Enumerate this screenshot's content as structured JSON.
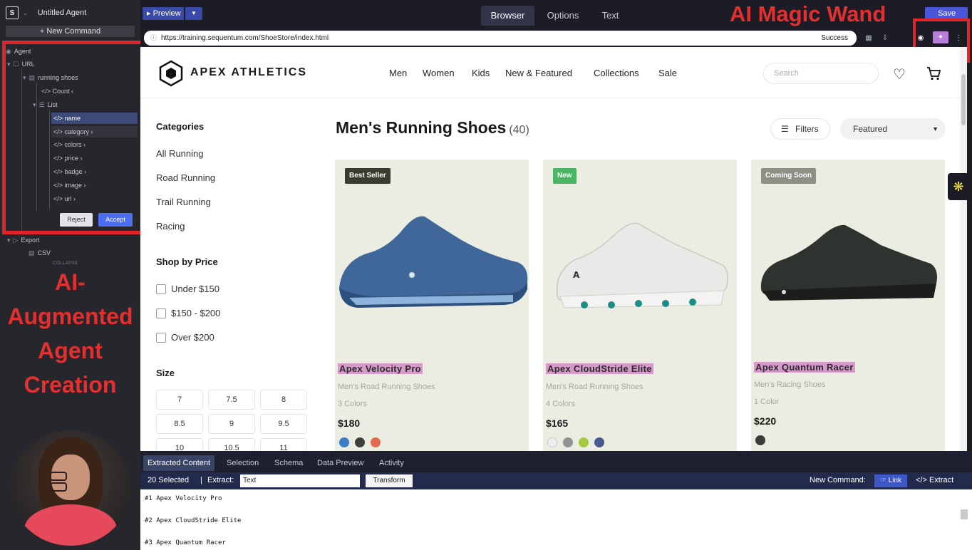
{
  "left_panel": {
    "title": "Untitled Agent",
    "new_command": "+ New Command",
    "tree": {
      "agent": "Agent",
      "url": "URL",
      "running_shoes": "running shoes",
      "count": "</> Count ‹",
      "list": "List",
      "fields": [
        "</> name",
        "</> category ›",
        "</> colors ›",
        "</> price ›",
        "</> badge ›",
        "</> image ›",
        "</> url ›"
      ],
      "export": "Export",
      "csv": "CSV",
      "collapse": "COLLAPSE"
    },
    "reject": "Reject",
    "accept": "Accept"
  },
  "annotations": {
    "left": [
      "AI-",
      "Augmented",
      "Agent",
      "Creation"
    ],
    "wand": "AI Magic Wand",
    "color": "#e0262b"
  },
  "toolbar": {
    "preview": "Preview",
    "tabs": [
      "Browser",
      "Options",
      "Text"
    ],
    "save": "Save"
  },
  "urlbar": {
    "url": "https://training.sequentum.com/ShoeStore/index.html",
    "status": "Success"
  },
  "site": {
    "brand": "APEX ATHLETICS",
    "nav": [
      "Men",
      "Women",
      "Kids",
      "New & Featured",
      "Collections",
      "Sale"
    ],
    "search_placeholder": "Search",
    "categories_heading": "Categories",
    "categories": [
      "All Running",
      "Road Running",
      "Trail Running",
      "Racing"
    ],
    "price_heading": "Shop by Price",
    "price_filters": [
      "Under $150",
      "$150 - $200",
      "Over $200"
    ],
    "size_heading": "Size",
    "sizes": [
      "7",
      "7.5",
      "8",
      "8.5",
      "9",
      "9.5",
      "10",
      "10.5",
      "11"
    ],
    "page_title": "Men's Running Shoes",
    "page_count": "(40)",
    "filters": "Filters",
    "sort": "Featured",
    "products": [
      {
        "badge": "Best Seller",
        "badge_color": "#3a3a2e",
        "name": "Apex Velocity Pro",
        "subtitle": "Men's Road Running Shoes",
        "colors_text": "3 Colors",
        "price": "$180",
        "swatches": [
          "#3b7dc4",
          "#3c3f3c",
          "#e36b4f"
        ],
        "shoe_color": "#3f679a"
      },
      {
        "badge": "New",
        "badge_color": "#4cb564",
        "name": "Apex CloudStride Elite",
        "subtitle": "Men's Road Running Shoes",
        "colors_text": "4 Colors",
        "price": "$165",
        "swatches": [
          "#eeeeee",
          "#8f9393",
          "#a5cc3c",
          "#4a5a8e"
        ],
        "shoe_color": "#e9e9e7"
      },
      {
        "badge": "Coming Soon",
        "badge_color": "#8f8f86",
        "name": "Apex Quantum Racer",
        "subtitle": "Men's Racing Shoes",
        "colors_text": "1 Color",
        "price": "$220",
        "swatches": [
          "#3b3d3c"
        ],
        "shoe_color": "#2f332f"
      }
    ]
  },
  "bottom": {
    "tabs": [
      "Extracted Content",
      "Selection",
      "Schema",
      "Data Preview",
      "Activity"
    ],
    "selected": "20 Selected",
    "separator": "|",
    "extract_label": "Extract:",
    "extract_value": "Text",
    "transform": "Transform",
    "new_command": "New Command:",
    "link": "Link",
    "extract_btn": "</> Extract",
    "lines": [
      "#1 Apex Velocity Pro",
      "#2 Apex CloudStride Elite",
      "#3 Apex Quantum Racer"
    ]
  }
}
